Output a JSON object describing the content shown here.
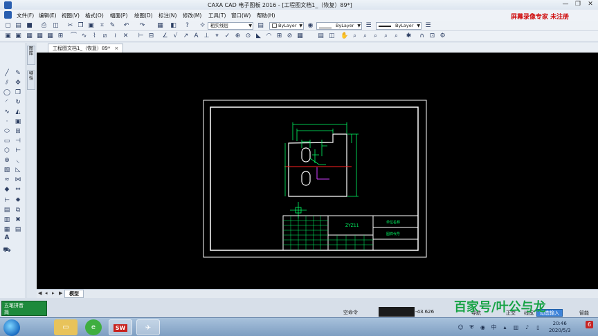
{
  "window": {
    "title": "CAXA CAD 电子图板 2016 - [工程图文档1_（恢复）89*]",
    "minimize": "—",
    "restore": "❐",
    "close": "✕"
  },
  "menu": [
    "文件(F)",
    "编辑(E)",
    "视图(V)",
    "格式(O)",
    "幅面(P)",
    "绘图(D)",
    "标注(N)",
    "修改(M)",
    "工具(T)",
    "窗口(W)",
    "帮助(H)"
  ],
  "promo": "屏幕录像专家 未注册",
  "toolbar": {
    "layer_combo": "粗实线层",
    "color_combo": "ByLayer",
    "linetype_combo": "ByLayer",
    "lineweight_combo": "ByLayer"
  },
  "side_tabs": [
    "图库",
    "特性"
  ],
  "document_tab": {
    "label": "工程图文档1_（恢复）89*",
    "close": "×"
  },
  "model_tab": "模型",
  "drawing": {
    "title_block_name": "ZYZ11",
    "title_block_labels": [
      "单位名称",
      "图样代号"
    ]
  },
  "status": {
    "ime_row1": "五笔拼音",
    "ime_row2": "简",
    "command_prompt": "空命令",
    "coordinate": "-43.626",
    "buttons": [
      "导航",
      "正交",
      "线宽",
      "动态输入",
      "智能"
    ],
    "active_button": "动态输入"
  },
  "watermark": "百家号/叶公与龙",
  "taskbar": {
    "time": "20:46",
    "date": "2020/5/3",
    "apps": [
      "windows-explorer",
      "360-browser",
      "solidworks-2016",
      "caxa-cad"
    ]
  },
  "colors": {
    "canvas": "#000000",
    "drawing_lines": "#ffffff",
    "dimension": "#00ff66",
    "centerline": "#ff2020",
    "promo": "#d01010"
  }
}
